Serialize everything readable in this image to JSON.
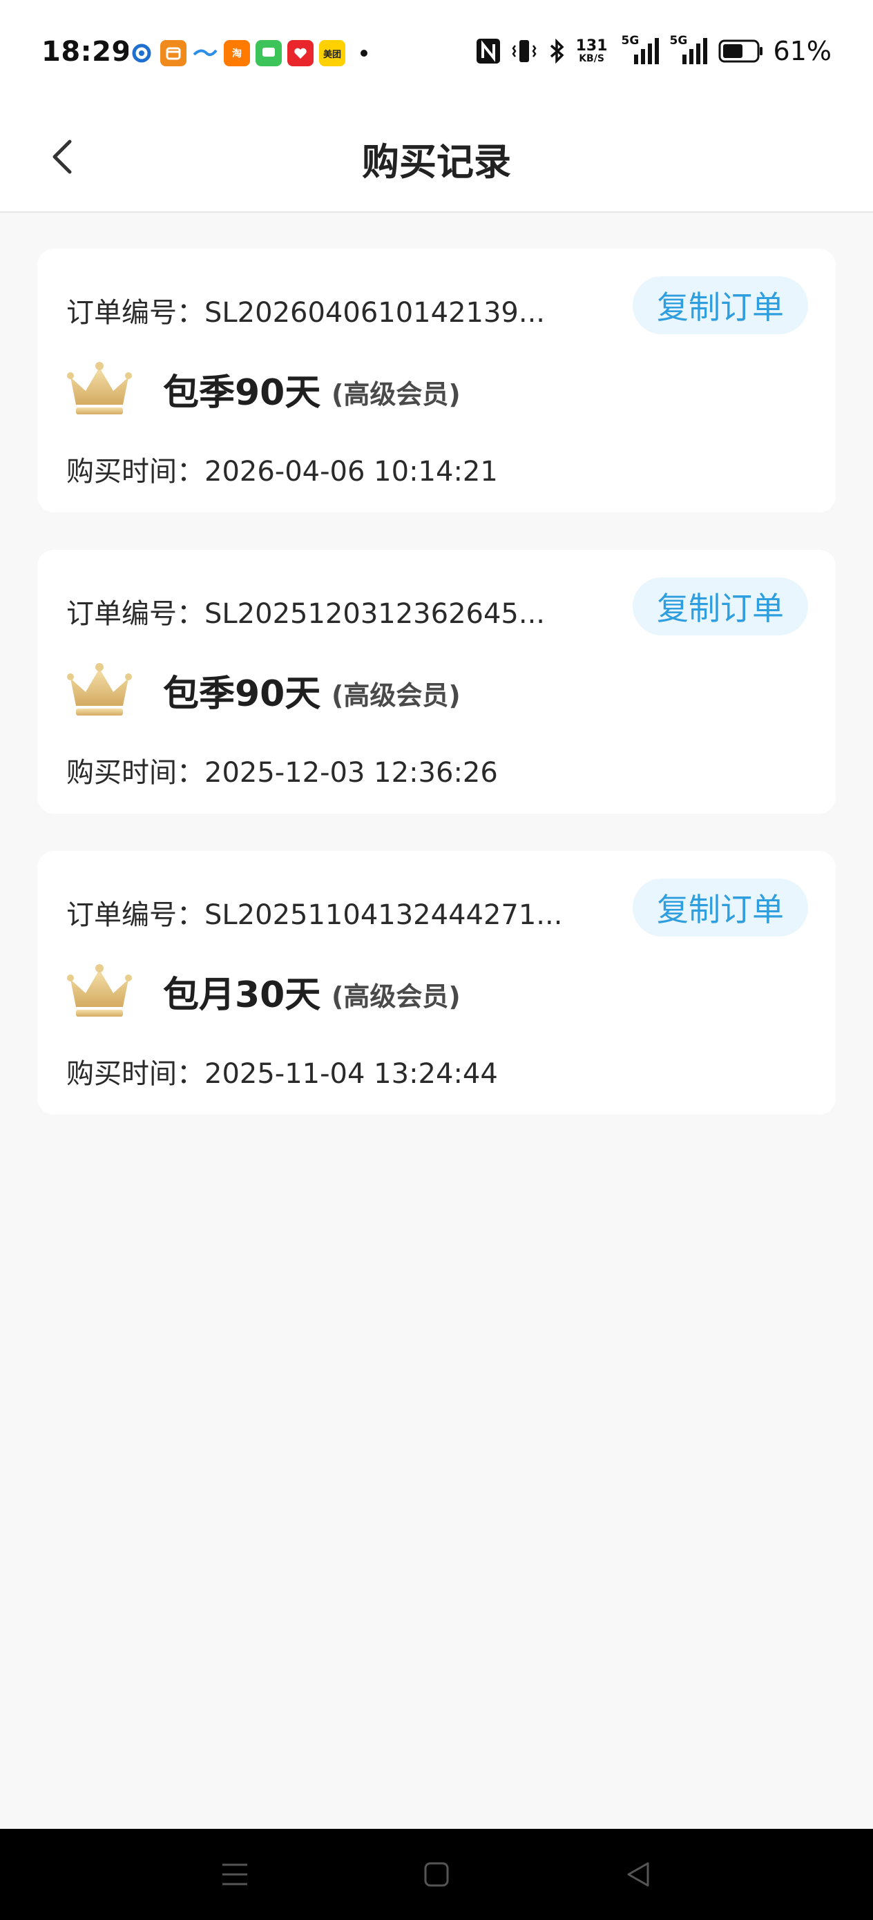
{
  "status_bar": {
    "time": "18:29",
    "net_speed_value": "131",
    "net_speed_unit": "KB/S",
    "signal_1_label": "5G",
    "signal_2_label": "5G",
    "battery_percent": "61%",
    "battery_level": 0.61,
    "app_icons": [
      {
        "name": "app-1-icon",
        "color": "#1f6fd1",
        "text": ""
      },
      {
        "name": "app-2-icon",
        "color": "#f08a1c",
        "text": ""
      },
      {
        "name": "app-3-icon",
        "color": "#2c8ee8",
        "text": ""
      },
      {
        "name": "taobao-icon",
        "color": "#ff7a00",
        "text": "淘"
      },
      {
        "name": "message-icon",
        "color": "#3cc45a",
        "text": ""
      },
      {
        "name": "app-6-icon",
        "color": "#e8262b",
        "text": ""
      },
      {
        "name": "meituan-icon",
        "color": "#ffd100",
        "text": "美团"
      }
    ]
  },
  "nav": {
    "title": "购买记录"
  },
  "orders": [
    {
      "order_label": "订单编号：SL2026040610142139...",
      "copy_label": "复制订单",
      "plan": "包季90天",
      "level": "(高级会员)",
      "time_label": "购买时间：2026-04-06 10:14:21"
    },
    {
      "order_label": "订单编号：SL2025120312362645...",
      "copy_label": "复制订单",
      "plan": "包季90天",
      "level": "(高级会员)",
      "time_label": "购买时间：2025-12-03 12:36:26"
    },
    {
      "order_label": "订单编号：SL20251104132444271...",
      "copy_label": "复制订单",
      "plan": "包月30天",
      "level": "(高级会员)",
      "time_label": "购买时间：2025-11-04 13:24:44"
    }
  ],
  "colors": {
    "accent": "#2f9ede",
    "copy_button_bg": "#eaf6fd",
    "crown_gold": "#e2c27a"
  }
}
